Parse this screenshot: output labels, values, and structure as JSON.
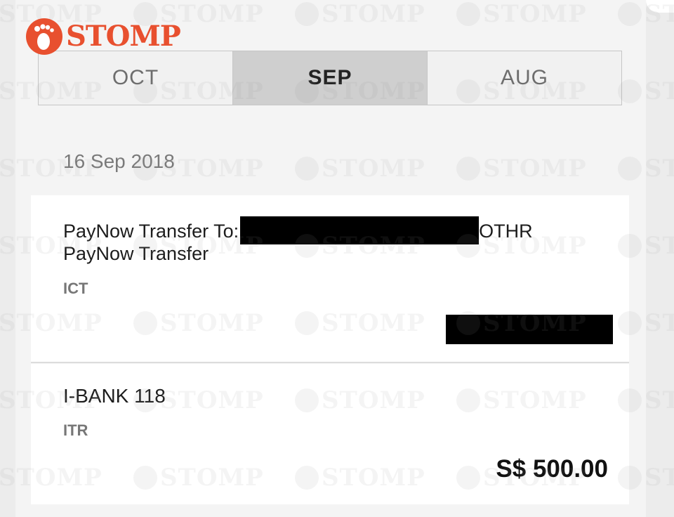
{
  "brand": {
    "logo_text": "STOMP",
    "color": "#e8502f",
    "watermark": "STOMP"
  },
  "tabs": [
    {
      "label": "OCT",
      "active": false
    },
    {
      "label": "SEP",
      "active": true
    },
    {
      "label": "AUG",
      "active": false
    }
  ],
  "date_header": "16 Sep 2018",
  "transactions": [
    {
      "line1_prefix": "PayNow Transfer To:",
      "line1_suffix": "OTHR",
      "line2": "PayNow Transfer",
      "code": "ICT",
      "amount_redacted": true
    },
    {
      "title": "I-BANK 118",
      "code": "ITR",
      "amount": "S$ 500.00"
    }
  ]
}
